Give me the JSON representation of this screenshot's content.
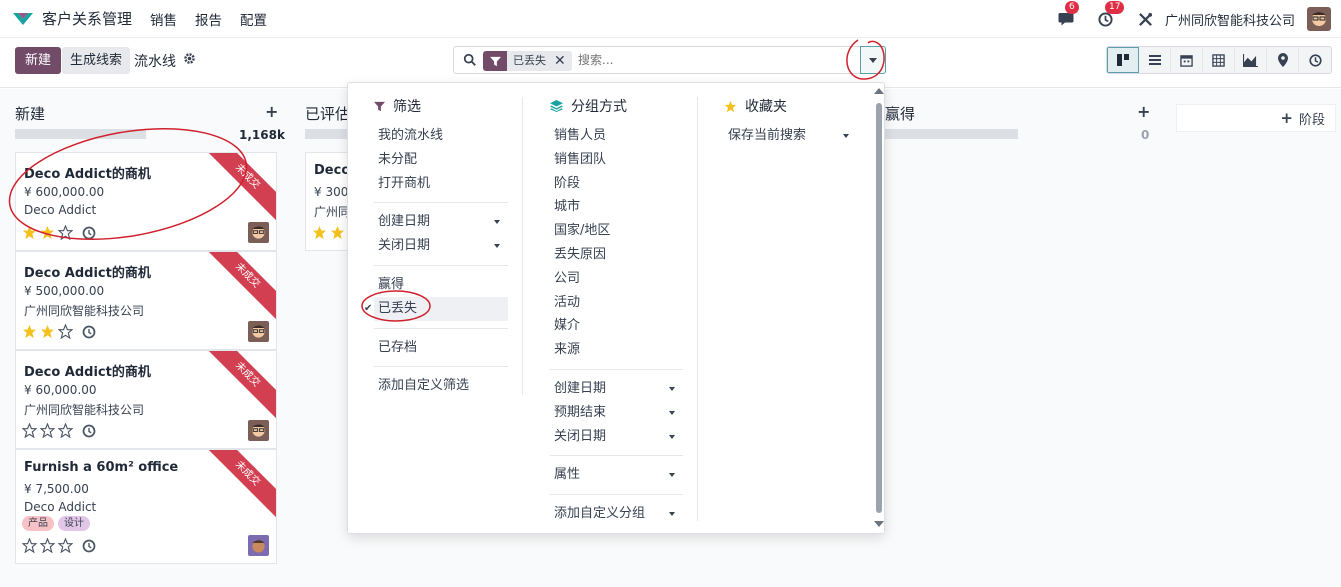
{
  "navbar": {
    "app_name": "客户关系管理",
    "menu": [
      "销售",
      "报告",
      "配置"
    ],
    "chat_badge": "6",
    "activity_badge": "17",
    "company": "广州同欣智能科技公司"
  },
  "control": {
    "new_label": "新建",
    "lead_label": "生成线索",
    "breadcrumb": "流水线",
    "facet_value": "已丢失",
    "facet_remove": "✕",
    "search_placeholder": "搜索..."
  },
  "kanban": {
    "columns": [
      {
        "title": "新建",
        "total": "1,168k",
        "progress": 0.6
      },
      {
        "title": "已评估",
        "progress": 0.2
      },
      {
        "title": "赢得",
        "total": "0",
        "progress": 1.0
      }
    ],
    "stage_add": "阶段",
    "cards": [
      {
        "title": "Deco Addict的商机",
        "amount": "¥ 600,000.00",
        "partner": "Deco Addict",
        "ribbon": "未成交",
        "stars": 2
      },
      {
        "title": "Deco Addict的商机",
        "amount": "¥ 500,000.00",
        "partner": "广州同欣智能科技公司",
        "ribbon": "未成交",
        "stars": 2
      },
      {
        "title": "Deco Addict的商机",
        "amount": "¥ 60,000.00",
        "partner": "广州同欣智能科技公司",
        "ribbon": "未成交",
        "stars": 0
      },
      {
        "title": "Furnish a 60m² office",
        "amount": "¥ 7,500.00",
        "partner": "Deco Addict",
        "ribbon": "未成交",
        "stars": 0,
        "tags": [
          {
            "label": "产品",
            "color": "#f7c1c6"
          },
          {
            "label": "设计",
            "color": "#e2c6e8"
          }
        ]
      }
    ],
    "col2_card": {
      "title": "Deco",
      "amount": "¥ 300,",
      "partner": "广州同",
      "stars": 2
    }
  },
  "dropdown": {
    "filters": {
      "heading": "筛选",
      "group1": [
        "我的流水线",
        "未分配",
        "打开商机"
      ],
      "group2": [
        "创建日期",
        "关闭日期"
      ],
      "group3": [
        "赢得",
        "已丢失"
      ],
      "group4": [
        "已存档"
      ],
      "custom": "添加自定义筛选"
    },
    "groupby": {
      "heading": "分组方式",
      "group1": [
        "销售人员",
        "销售团队",
        "阶段",
        "城市",
        "国家/地区",
        "丢失原因",
        "公司",
        "活动",
        "媒介",
        "来源"
      ],
      "group2": [
        "创建日期",
        "预期结束",
        "关闭日期"
      ],
      "group3": [
        "属性"
      ],
      "custom": "添加自定义分组"
    },
    "favorites": {
      "heading": "收藏夹",
      "save": "保存当前搜索"
    }
  },
  "colors": {
    "brand": "#714b67",
    "accent": "#5a9fa9",
    "ribbon": "#d23f51",
    "annotation": "#d0202c"
  }
}
